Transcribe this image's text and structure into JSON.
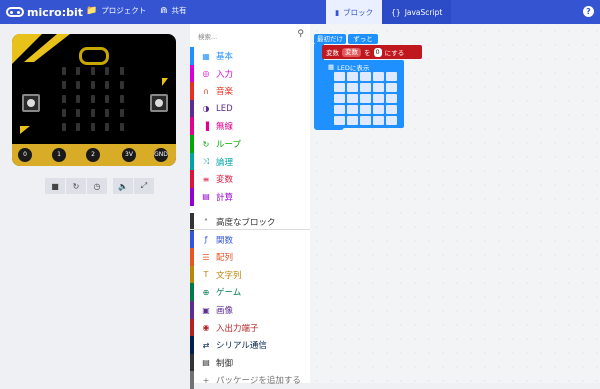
{
  "app": {
    "logo_text": "micro:bit"
  },
  "topbar": {
    "projects_label": "プロジェクト",
    "share_label": "共有",
    "blocks_tab": "ブロック",
    "javascript_tab": "JavaScript",
    "help_icon": "?"
  },
  "simulator": {
    "pins": [
      "0",
      "1",
      "2",
      "3V",
      "GND"
    ],
    "tools": [
      "stop-icon",
      "restart-icon",
      "slowmo-icon",
      "mute-icon",
      "fullscreen-icon"
    ]
  },
  "toolbox": {
    "search_placeholder": "検索...",
    "categories": [
      {
        "label": "基本",
        "color": "#1e90ff",
        "icon": "grid-icon"
      },
      {
        "label": "入力",
        "color": "#d400d4",
        "icon": "target-icon"
      },
      {
        "label": "音楽",
        "color": "#e63022",
        "icon": "headphones-icon"
      },
      {
        "label": "LED",
        "color": "#5c2d91",
        "icon": "toggle-icon"
      },
      {
        "label": "無線",
        "color": "#e3008c",
        "icon": "signal-icon"
      },
      {
        "label": "ループ",
        "color": "#00aa00",
        "icon": "refresh-icon"
      },
      {
        "label": "論理",
        "color": "#00a4a6",
        "icon": "shuffle-icon"
      },
      {
        "label": "変数",
        "color": "#dc143c",
        "icon": "list-icon"
      },
      {
        "label": "計算",
        "color": "#9400d3",
        "icon": "calculator-icon"
      }
    ],
    "advanced": [
      {
        "label": "高度なブロック",
        "color": "#333333",
        "icon": "chevron-up-icon"
      },
      {
        "label": "関数",
        "color": "#3455db",
        "icon": "function-icon"
      },
      {
        "label": "配列",
        "color": "#e65722",
        "icon": "array-icon"
      },
      {
        "label": "文字列",
        "color": "#b8860b",
        "icon": "text-icon"
      },
      {
        "label": "ゲーム",
        "color": "#007a4b",
        "icon": "gamepad-icon"
      },
      {
        "label": "画像",
        "color": "#5c2d91",
        "icon": "image-icon"
      },
      {
        "label": "入出力端子",
        "color": "#b22222",
        "icon": "pin-icon"
      },
      {
        "label": "シリアル通信",
        "color": "#002050",
        "icon": "usb-icon"
      },
      {
        "label": "制御",
        "color": "#333333",
        "icon": "control-icon"
      },
      {
        "label": "パッケージを追加する",
        "color": "#717171",
        "icon": "plus-icon"
      }
    ]
  },
  "workspace": {
    "on_start": "最初だけ",
    "forever": "ずっと",
    "set_var": {
      "prefix": "変数",
      "var_name": "変数",
      "mid": "を",
      "value": "0",
      "suffix": "にする"
    },
    "show_leds": "LEDに表示"
  }
}
